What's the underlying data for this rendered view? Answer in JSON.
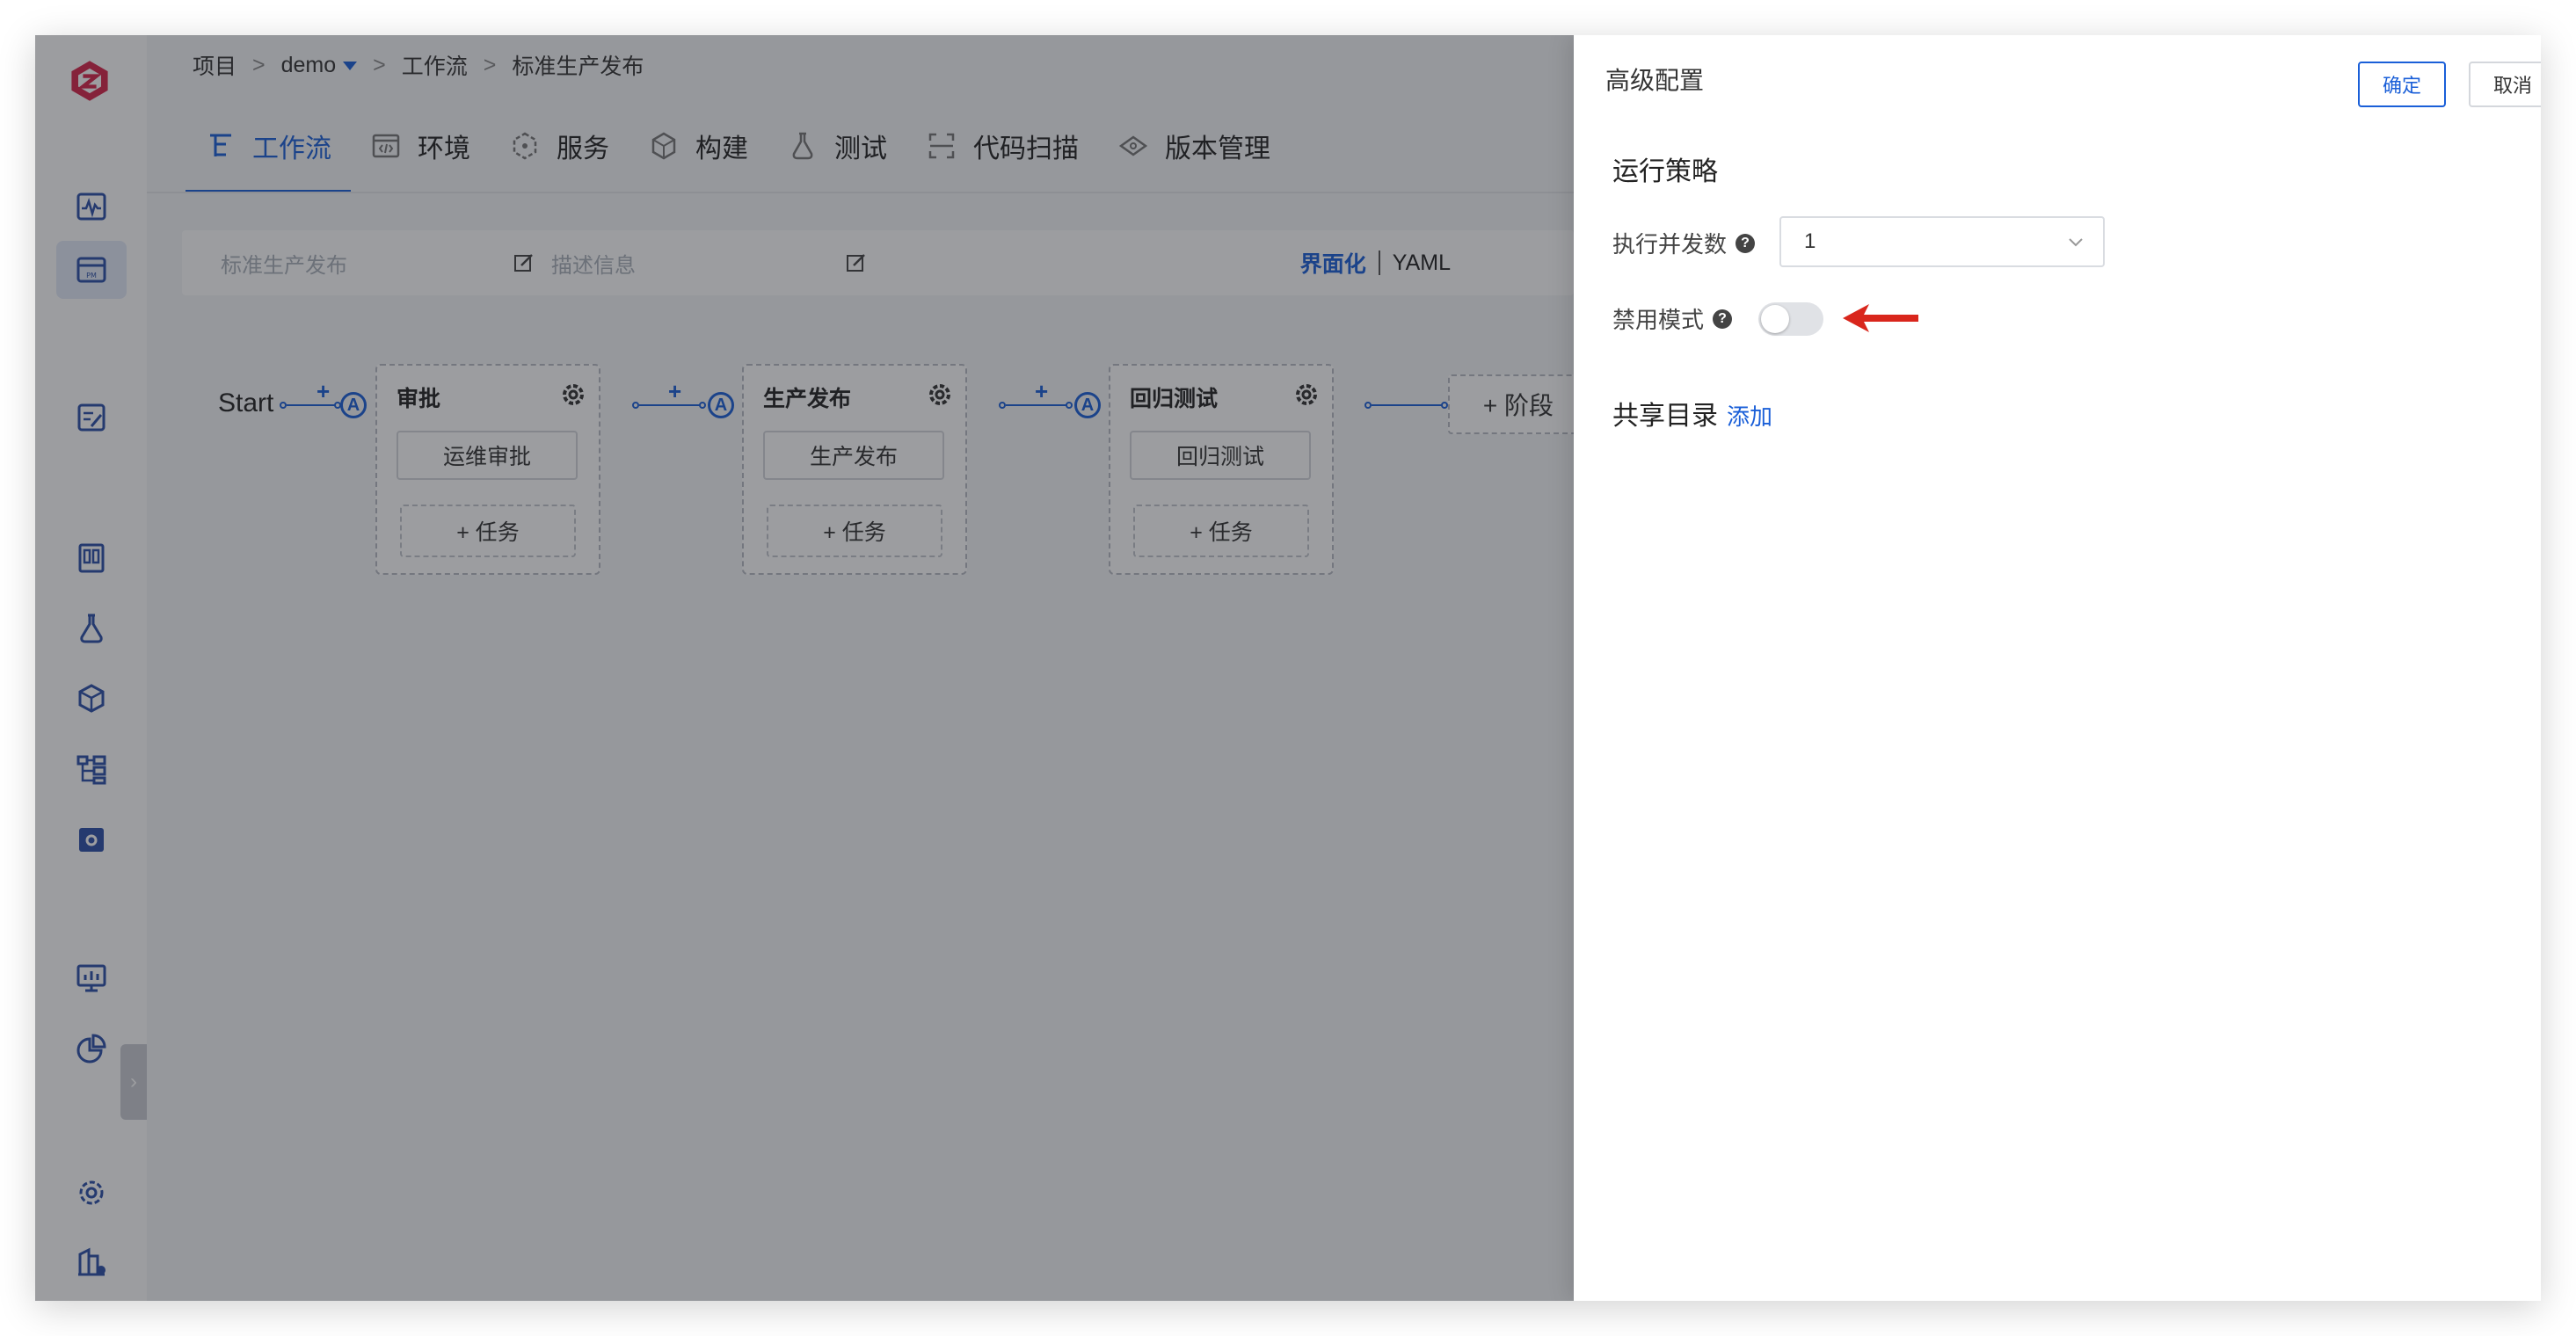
{
  "breadcrumb": {
    "project": "项目",
    "sep": ">",
    "demo": "demo",
    "workflow": "工作流",
    "current": "标准生产发布"
  },
  "tabs": [
    {
      "label": "工作流",
      "icon": "workflow-icon"
    },
    {
      "label": "环境",
      "icon": "environment-icon"
    },
    {
      "label": "服务",
      "icon": "service-icon"
    },
    {
      "label": "构建",
      "icon": "build-icon"
    },
    {
      "label": "测试",
      "icon": "test-icon"
    },
    {
      "label": "代码扫描",
      "icon": "scan-icon"
    },
    {
      "label": "版本管理",
      "icon": "version-icon"
    }
  ],
  "infobar": {
    "name_placeholder": "标准生产发布",
    "desc_placeholder": "描述信息",
    "view_ui": "界面化",
    "view_yaml": "YAML"
  },
  "workflow": {
    "start": "Start",
    "plus": "+",
    "approval_marker": "A",
    "stages": [
      {
        "title": "审批",
        "job": "运维审批",
        "add_task": "+ 任务"
      },
      {
        "title": "生产发布",
        "job": "生产发布",
        "add_task": "+ 任务"
      },
      {
        "title": "回归测试",
        "job": "回归测试",
        "add_task": "+ 任务"
      }
    ],
    "add_stage": "+ 阶段"
  },
  "drawer": {
    "title": "高级配置",
    "ok": "确定",
    "cancel": "取消",
    "run_policy": "运行策略",
    "concurrency_label": "执行并发数",
    "concurrency_value": "1",
    "disable_label": "禁用模式",
    "disable_on": false,
    "help": "?",
    "shared_dir": "共享目录",
    "add": "添加"
  },
  "colors": {
    "accent": "#1a5fd8",
    "brand": "#d6254a",
    "annotation": "#d9261c"
  }
}
